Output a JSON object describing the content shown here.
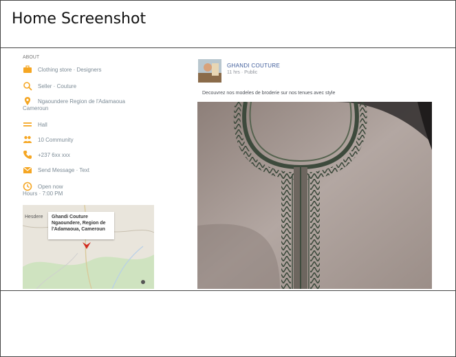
{
  "header": {
    "title": "Home Screenshot"
  },
  "about": {
    "label": "ABOUT",
    "items": [
      {
        "icon": "briefcase-icon",
        "text": "Clothing store · Designers",
        "color": "#f5a623"
      },
      {
        "icon": "magnifier-icon",
        "text": "Seller · Couture",
        "color": "#f5a623"
      },
      {
        "icon": "location-pin-icon",
        "text": "Ngaoundere Region de l'Adamaoua",
        "text2": "Cameroun",
        "color": "#f5a623"
      },
      {
        "icon": "menu-lines-icon",
        "text": "Hall",
        "color": "#f5a623"
      },
      {
        "icon": "people-icon",
        "text": "10 Community",
        "color": "#f5a623"
      },
      {
        "icon": "phone-icon",
        "text": "+237 6xx xxx",
        "color": "#f5a623"
      },
      {
        "icon": "mail-icon",
        "text": "Send Message · Text",
        "color": "#f5a623"
      },
      {
        "icon": "clock-icon",
        "text": "Open now",
        "text2": "Hours · 7:00 PM",
        "color": "#f5a623"
      }
    ],
    "map": {
      "side_label": "Hesdere",
      "bubble_lines": [
        "Ghandi Couture",
        "Ngaoundere, Region de",
        "l'Adamaoua, Cameroun"
      ]
    }
  },
  "post": {
    "page_name": "GHANDI COUTURE",
    "time": "11 hrs · Public",
    "text": "Decouvrez nos modeles de broderie sur nos tenues avec style",
    "link_color": "#3b5998"
  }
}
